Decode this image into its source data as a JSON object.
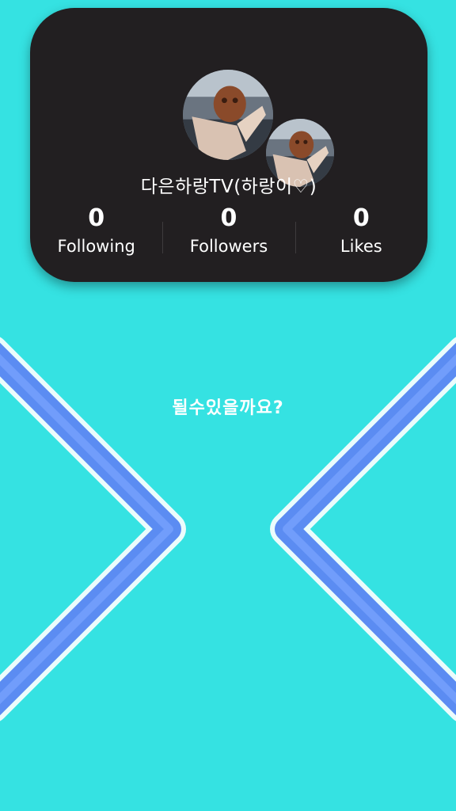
{
  "profile": {
    "username": "다은하랑TV(하랑이♡)",
    "avatar_icon": "dog-photo-avatar",
    "mini_avatar_icon": "dog-photo-mini-avatar"
  },
  "stats": [
    {
      "value": "0",
      "label": "Following"
    },
    {
      "value": "0",
      "label": "Followers"
    },
    {
      "value": "0",
      "label": "Likes"
    }
  ],
  "caption": "될수있을까요?",
  "colors": {
    "background": "#35e2e2",
    "card": "#221f21",
    "chevron_stroke": "#5b8cf2",
    "chevron_outline": "#ffffff"
  },
  "decorations": [
    "left-chevron-icon",
    "right-chevron-icon"
  ]
}
